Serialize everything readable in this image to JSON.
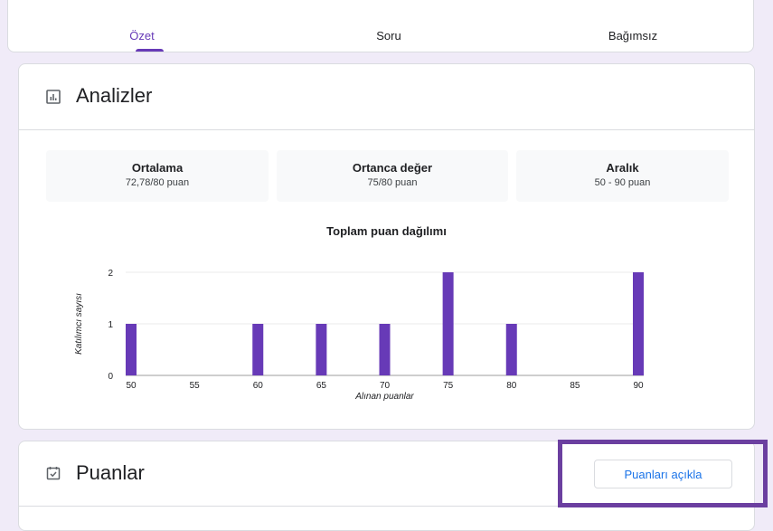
{
  "tabs": [
    {
      "label": "Özet",
      "active": true
    },
    {
      "label": "Soru",
      "active": false
    },
    {
      "label": "Bağımsız",
      "active": false
    }
  ],
  "analytics": {
    "title": "Analizler",
    "icon": "bar-chart-icon",
    "stats": [
      {
        "label": "Ortalama",
        "value": "72,78/80 puan"
      },
      {
        "label": "Ortanca değer",
        "value": "75/80 puan"
      },
      {
        "label": "Aralık",
        "value": "50 - 90 puan"
      }
    ]
  },
  "chart_data": {
    "type": "bar",
    "title": "Toplam puan dağılımı",
    "xlabel": "Alınan puanlar",
    "ylabel": "Katılımcı sayısı",
    "x": [
      50,
      60,
      65,
      70,
      75,
      80,
      90
    ],
    "values": [
      1,
      1,
      1,
      1,
      2,
      1,
      2
    ],
    "x_ticks": [
      "50",
      "55",
      "60",
      "65",
      "70",
      "75",
      "80",
      "85",
      "90"
    ],
    "y_ticks": [
      "0",
      "1",
      "2"
    ],
    "xlim": [
      50,
      90
    ],
    "ylim": [
      0,
      2
    ],
    "grid": true,
    "bar_color": "#673ab7"
  },
  "scores": {
    "title": "Puanlar",
    "icon": "checkbox-calendar-icon",
    "release_button": "Puanları açıkla"
  },
  "colors": {
    "accent": "#673ab7",
    "highlight": "#6b3fa0",
    "link": "#1a73e8"
  }
}
